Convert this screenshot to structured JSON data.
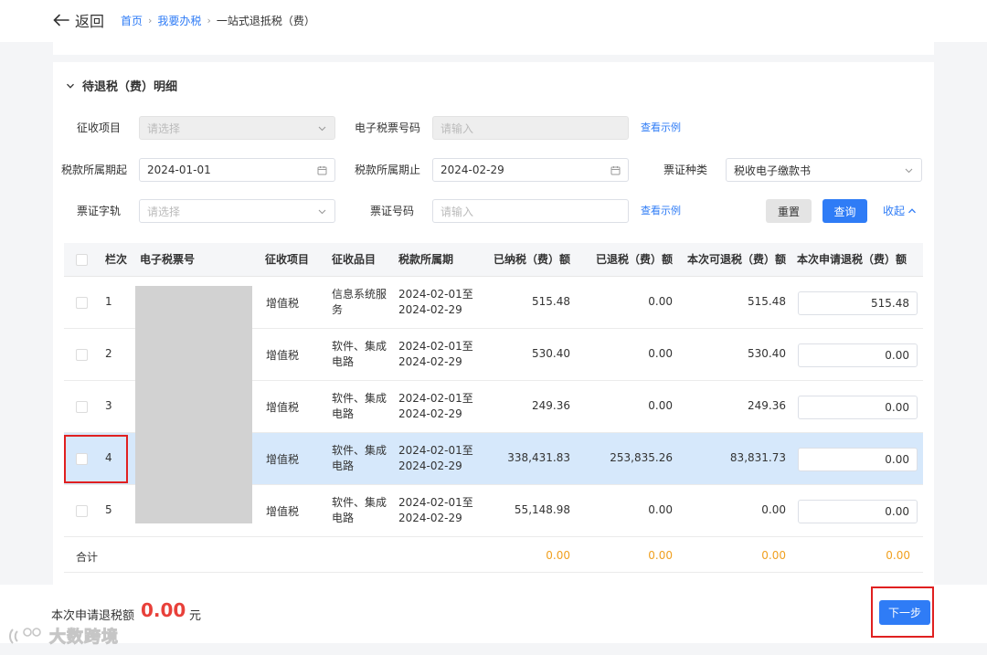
{
  "header": {
    "back_label": "返回",
    "breadcrumb": [
      "首页",
      "我要办税",
      "一站式退抵税（费）"
    ]
  },
  "section": {
    "title": "待退税（费）明细"
  },
  "form": {
    "levy_item": {
      "label": "征收项目",
      "placeholder": "请选择"
    },
    "e_ticket_no": {
      "label": "电子税票号码",
      "placeholder": "请输入"
    },
    "example_link": "查看示例",
    "period_start": {
      "label": "税款所属期起",
      "value": "2024-01-01"
    },
    "period_end": {
      "label": "税款所属期止",
      "value": "2024-02-29"
    },
    "voucher_type": {
      "label": "票证种类",
      "value": "税收电子缴款书"
    },
    "voucher_word": {
      "label": "票证字轨",
      "placeholder": "请选择"
    },
    "voucher_no": {
      "label": "票证号码",
      "placeholder": "请输入"
    },
    "reset_label": "重置",
    "query_label": "查询",
    "collapse_label": "收起"
  },
  "table": {
    "headers": [
      "栏次",
      "电子税票号",
      "征收项目",
      "征收品目",
      "税款所属期",
      "已纳税（费）额",
      "已退税（费）额",
      "本次可退税（费）额",
      "本次申请退税（费）额"
    ],
    "rows": [
      {
        "no": "1",
        "levy": "增值税",
        "item_1": "信息系统服",
        "item_2": "务",
        "period_1": "2024-02-01至",
        "period_2": "2024-02-29",
        "paid": "515.48",
        "refunded": "0.00",
        "refundable": "515.48",
        "apply": "515.48"
      },
      {
        "no": "2",
        "levy": "增值税",
        "item_1": "软件、集成",
        "item_2": "电路",
        "period_1": "2024-02-01至",
        "period_2": "2024-02-29",
        "paid": "530.40",
        "refunded": "0.00",
        "refundable": "530.40",
        "apply": "0.00"
      },
      {
        "no": "3",
        "levy": "增值税",
        "item_1": "软件、集成",
        "item_2": "电路",
        "period_1": "2024-02-01至",
        "period_2": "2024-02-29",
        "paid": "249.36",
        "refunded": "0.00",
        "refundable": "249.36",
        "apply": "0.00"
      },
      {
        "no": "4",
        "levy": "增值税",
        "item_1": "软件、集成",
        "item_2": "电路",
        "period_1": "2024-02-01至",
        "period_2": "2024-02-29",
        "paid": "338,431.83",
        "refunded": "253,835.26",
        "refundable": "83,831.73",
        "apply": "0.00"
      },
      {
        "no": "5",
        "levy": "增值税",
        "item_1": "软件、集成",
        "item_2": "电路",
        "period_1": "2024-02-01至",
        "period_2": "2024-02-29",
        "paid": "55,148.98",
        "refunded": "0.00",
        "refundable": "0.00",
        "apply": "0.00"
      }
    ],
    "total": {
      "label": "合计",
      "paid": "0.00",
      "refunded": "0.00",
      "refundable": "0.00",
      "apply": "0.00"
    }
  },
  "footer": {
    "label": "本次申请退税额",
    "amount": "0.00",
    "unit": "元",
    "next_label": "下一步",
    "watermark": "大数跨境"
  },
  "colors": {
    "primary": "#2f7cf6",
    "highlight_row": "#d6e8fb",
    "total_amount": "#f0a020",
    "footer_amount": "#e8403a",
    "annotation_box": "#e02020"
  }
}
